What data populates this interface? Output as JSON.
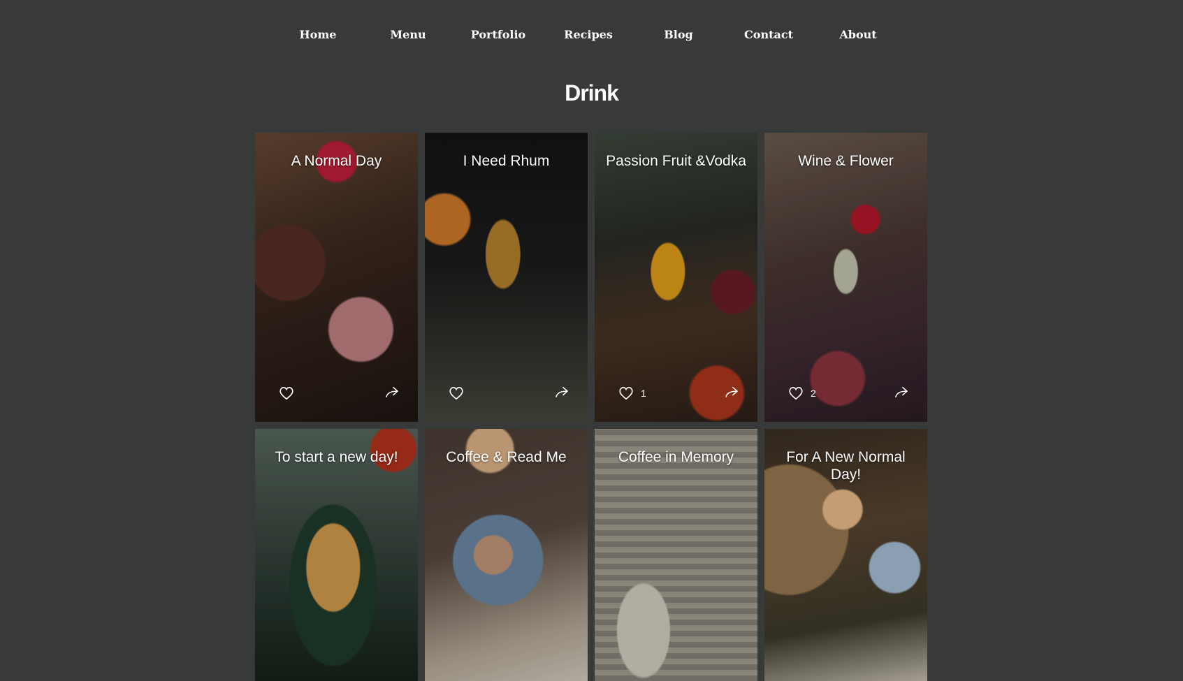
{
  "nav": {
    "items": [
      "Home",
      "Menu",
      "Portfolio",
      "Recipes",
      "Blog",
      "Contact",
      "About"
    ]
  },
  "page": {
    "title": "Drink"
  },
  "posts": [
    {
      "title": "A Normal Day",
      "likes": ""
    },
    {
      "title": "I Need Rhum",
      "likes": ""
    },
    {
      "title": "Passion Fruit &Vodka",
      "likes": "1"
    },
    {
      "title": "Wine & Flower",
      "likes": "2"
    },
    {
      "title": "To start a new day!",
      "likes": ""
    },
    {
      "title": "Coffee & Read Me",
      "likes": ""
    },
    {
      "title": "Coffee in Memory",
      "likes": ""
    },
    {
      "title": "For A New Normal Day!",
      "likes": ""
    }
  ],
  "colors": {
    "background": "#383939",
    "text": "#ffffff"
  },
  "icons": {
    "like": "heart-icon",
    "share": "share-arrow-icon"
  }
}
